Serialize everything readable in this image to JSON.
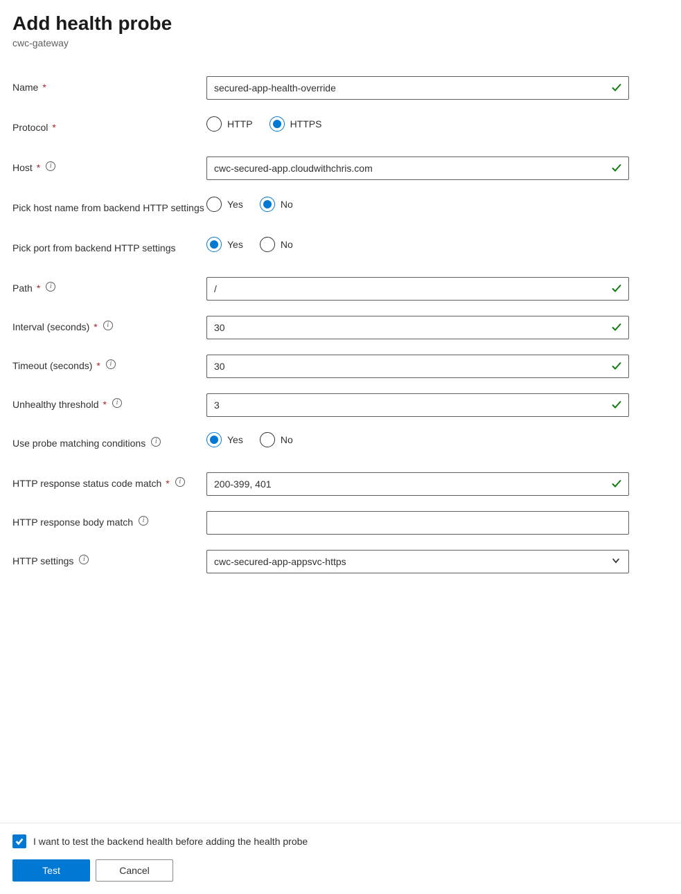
{
  "header": {
    "title": "Add health probe",
    "subtitle": "cwc-gateway"
  },
  "labels": {
    "name": "Name",
    "protocol": "Protocol",
    "host": "Host",
    "pickHostFromBackend": "Pick host name from backend HTTP settings",
    "pickPortFromBackend": "Pick port from backend HTTP settings",
    "path": "Path",
    "interval": "Interval (seconds)",
    "timeout": "Timeout (seconds)",
    "unhealthyThreshold": "Unhealthy threshold",
    "useProbeMatch": "Use probe matching conditions",
    "statusCodeMatch": "HTTP response status code match",
    "bodyMatch": "HTTP response body match",
    "httpSettings": "HTTP settings"
  },
  "values": {
    "name": "secured-app-health-override",
    "host": "cwc-secured-app.cloudwithchris.com",
    "path": "/",
    "interval": "30",
    "timeout": "30",
    "unhealthyThreshold": "3",
    "statusCodeMatch": "200-399, 401",
    "bodyMatch": "",
    "httpSettings": "cwc-secured-app-appsvc-https"
  },
  "options": {
    "protocol": {
      "http": "HTTP",
      "https": "HTTPS",
      "selected": "https"
    },
    "pickHostFromBackend": {
      "yes": "Yes",
      "no": "No",
      "selected": "no"
    },
    "pickPortFromBackend": {
      "yes": "Yes",
      "no": "No",
      "selected": "yes"
    },
    "useProbeMatch": {
      "yes": "Yes",
      "no": "No",
      "selected": "yes"
    }
  },
  "footer": {
    "testCheckboxLabel": "I want to test the backend health before adding the health probe",
    "testCheckboxChecked": true,
    "testButton": "Test",
    "cancelButton": "Cancel"
  }
}
